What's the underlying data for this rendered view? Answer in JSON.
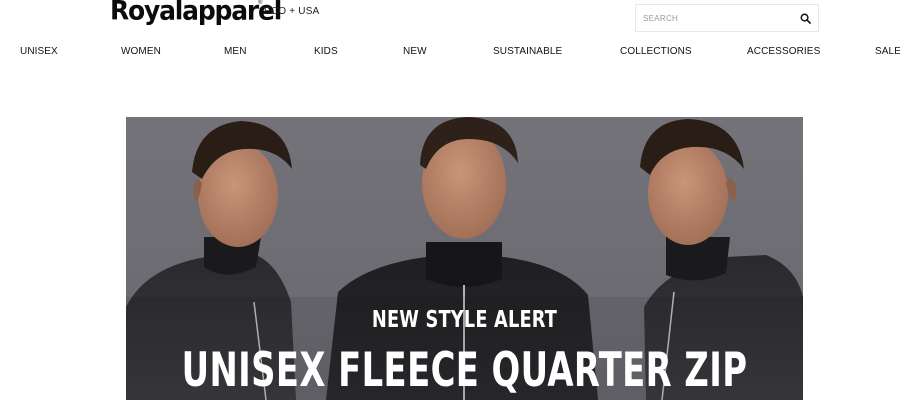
{
  "header": {
    "logo_text": "Royalapparel",
    "logo_mark": "®",
    "tagline": "ECO + USA"
  },
  "search": {
    "placeholder": "SEARCH",
    "value": "",
    "icon": "search-icon"
  },
  "nav": {
    "items": [
      {
        "label": "UNISEX"
      },
      {
        "label": "WOMEN"
      },
      {
        "label": "MEN"
      },
      {
        "label": "KIDS"
      },
      {
        "label": "NEW"
      },
      {
        "label": "SUSTAINABLE"
      },
      {
        "label": "COLLECTIONS"
      },
      {
        "label": "ACCESSORIES"
      },
      {
        "label": "SALE"
      }
    ]
  },
  "hero": {
    "kicker": "NEW STYLE ALERT",
    "headline": "UNISEX FLEECE QUARTER ZIP",
    "background_color": "#6f6f75",
    "garment_color": "#1c1c1e"
  }
}
